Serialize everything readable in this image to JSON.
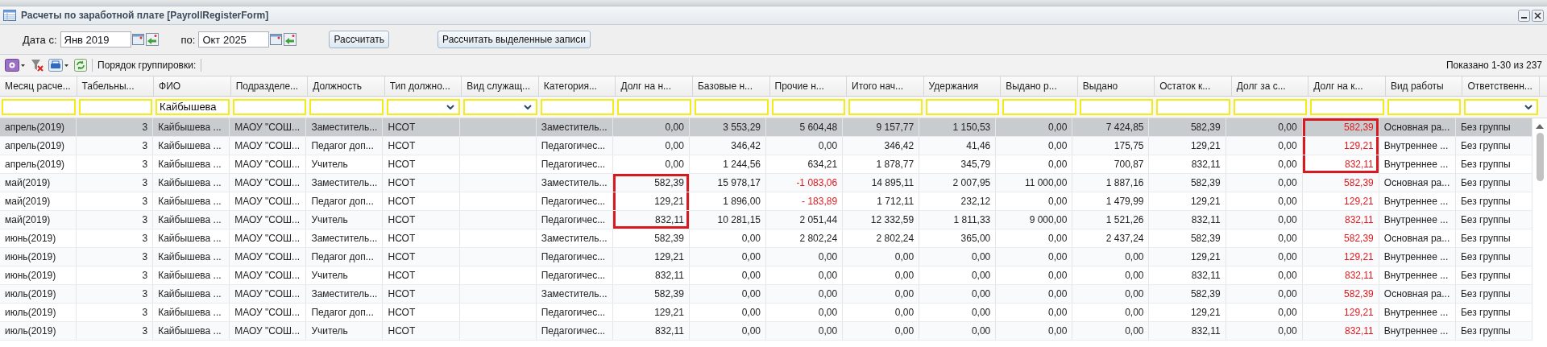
{
  "window": {
    "title": "Расчеты по заработной плате [PayrollRegisterForm]"
  },
  "period": {
    "from_label": "Дата с:",
    "from_value": "Янв 2019",
    "to_label": "по:",
    "to_value": "Окт 2025"
  },
  "buttons": [
    "Рассчитать",
    "Рассчитать выделенные записи"
  ],
  "toolbar": {
    "grouping_label": "Порядок группировки:",
    "paging": "Показано 1-30 из 237"
  },
  "columns": [
    {
      "label": "Месяц расче...",
      "kind": "text"
    },
    {
      "label": "Табельны...",
      "kind": "number"
    },
    {
      "label": "ФИО",
      "kind": "text",
      "filter_value": "Кайбышева"
    },
    {
      "label": "Подразделе...",
      "kind": "text"
    },
    {
      "label": "Должность",
      "kind": "text"
    },
    {
      "label": "Тип должно...",
      "kind": "choice"
    },
    {
      "label": "Вид служащ...",
      "kind": "choice"
    },
    {
      "label": "Категория...",
      "kind": "text"
    },
    {
      "label": "Долг на н...",
      "kind": "number"
    },
    {
      "label": "Базовые н...",
      "kind": "number"
    },
    {
      "label": "Прочие н...",
      "kind": "number"
    },
    {
      "label": "Итого нач...",
      "kind": "number"
    },
    {
      "label": "Удержания",
      "kind": "number"
    },
    {
      "label": "Выдано р...",
      "kind": "number"
    },
    {
      "label": "Выдано",
      "kind": "number"
    },
    {
      "label": "Остаток к...",
      "kind": "number"
    },
    {
      "label": "Долг за с...",
      "kind": "number"
    },
    {
      "label": "Долг на к...",
      "kind": "number"
    },
    {
      "label": "Вид работы",
      "kind": "text"
    },
    {
      "label": "Ответственн...",
      "kind": "choice"
    }
  ],
  "rows": [
    {
      "selected": true,
      "cells": [
        "апрель(2019)",
        "3",
        "Кайбышева ...",
        "МАОУ \"СОШ...",
        "Заместитель...",
        "НСОТ",
        "",
        "Заместитель...",
        "0,00",
        "3 553,29",
        "5 604,48",
        "9 157,77",
        "1 150,53",
        "0,00",
        "7 424,85",
        "582,39",
        "0,00",
        {
          "text": "582,39",
          "red": true,
          "framed": true
        },
        "Основная ра...",
        "Без группы"
      ]
    },
    {
      "selected": false,
      "cells": [
        "апрель(2019)",
        "3",
        "Кайбышева ...",
        "МАОУ \"СОШ...",
        "Педагог доп...",
        "НСОТ",
        "",
        "Педагогичес...",
        "0,00",
        "346,42",
        "0,00",
        "346,42",
        "41,46",
        "0,00",
        "175,75",
        "129,21",
        "0,00",
        {
          "text": "129,21",
          "red": true,
          "framed": true
        },
        "Внутреннее ...",
        "Без группы"
      ]
    },
    {
      "selected": false,
      "cells": [
        "апрель(2019)",
        "3",
        "Кайбышева ...",
        "МАОУ \"СОШ...",
        "Учитель",
        "НСОТ",
        "",
        "Педагогичес...",
        "0,00",
        "1 244,56",
        "634,21",
        "1 878,77",
        "345,79",
        "0,00",
        "700,87",
        "832,11",
        "0,00",
        {
          "text": "832,11",
          "red": true,
          "framed": true
        },
        "Внутреннее ...",
        "Без группы"
      ]
    },
    {
      "selected": false,
      "cells": [
        "май(2019)",
        "3",
        "Кайбышева ...",
        "МАОУ \"СОШ...",
        "Заместитель...",
        "НСОТ",
        "",
        "Заместитель...",
        {
          "text": "582,39",
          "red": false,
          "framed": true
        },
        "15 978,17",
        {
          "text": "-1 083,06",
          "red": true,
          "framed": false
        },
        "14 895,11",
        "2 007,95",
        "11 000,00",
        "1 887,16",
        "582,39",
        "0,00",
        {
          "text": "582,39",
          "red": true,
          "framed": false
        },
        "Основная ра...",
        "Без группы"
      ]
    },
    {
      "selected": false,
      "cells": [
        "май(2019)",
        "3",
        "Кайбышева ...",
        "МАОУ \"СОШ...",
        "Педагог доп...",
        "НСОТ",
        "",
        "Педагогичес...",
        {
          "text": "129,21",
          "red": false,
          "framed": true
        },
        "1 896,00",
        {
          "text": "- 183,89",
          "red": true,
          "framed": false
        },
        "1 712,11",
        "232,12",
        "0,00",
        "1 479,99",
        "129,21",
        "0,00",
        {
          "text": "129,21",
          "red": true,
          "framed": false
        },
        "Внутреннее ...",
        "Без группы"
      ]
    },
    {
      "selected": false,
      "cells": [
        "май(2019)",
        "3",
        "Кайбышева ...",
        "МАОУ \"СОШ...",
        "Учитель",
        "НСОТ",
        "",
        "Педагогичес...",
        {
          "text": "832,11",
          "red": false,
          "framed": true
        },
        "10 281,15",
        "2 051,44",
        "12 332,59",
        "1 811,33",
        "9 000,00",
        "1 521,26",
        "832,11",
        "0,00",
        {
          "text": "832,11",
          "red": true,
          "framed": false
        },
        "Внутреннее ...",
        "Без группы"
      ]
    },
    {
      "selected": false,
      "cells": [
        "июнь(2019)",
        "3",
        "Кайбышева ...",
        "МАОУ \"СОШ...",
        "Заместитель...",
        "НСОТ",
        "",
        "Заместитель...",
        "582,39",
        "0,00",
        "2 802,24",
        "2 802,24",
        "365,00",
        "0,00",
        "2 437,24",
        "582,39",
        "0,00",
        {
          "text": "582,39",
          "red": true,
          "framed": false
        },
        "Основная ра...",
        "Без группы"
      ]
    },
    {
      "selected": false,
      "cells": [
        "июнь(2019)",
        "3",
        "Кайбышева ...",
        "МАОУ \"СОШ...",
        "Педагог доп...",
        "НСОТ",
        "",
        "Педагогичес...",
        "129,21",
        "0,00",
        "0,00",
        "0,00",
        "0,00",
        "0,00",
        "0,00",
        "129,21",
        "0,00",
        {
          "text": "129,21",
          "red": true,
          "framed": false
        },
        "Внутреннее ...",
        "Без группы"
      ]
    },
    {
      "selected": false,
      "cells": [
        "июнь(2019)",
        "3",
        "Кайбышева ...",
        "МАОУ \"СОШ...",
        "Учитель",
        "НСОТ",
        "",
        "Педагогичес...",
        "832,11",
        "0,00",
        "0,00",
        "0,00",
        "0,00",
        "0,00",
        "0,00",
        "832,11",
        "0,00",
        {
          "text": "832,11",
          "red": true,
          "framed": false
        },
        "Внутреннее ...",
        "Без группы"
      ]
    },
    {
      "selected": false,
      "cells": [
        "июль(2019)",
        "3",
        "Кайбышева ...",
        "МАОУ \"СОШ...",
        "Заместитель...",
        "НСОТ",
        "",
        "Заместитель...",
        "582,39",
        "0,00",
        "0,00",
        "0,00",
        "0,00",
        "0,00",
        "0,00",
        "582,39",
        "0,00",
        {
          "text": "582,39",
          "red": true,
          "framed": false
        },
        "Основная ра...",
        "Без группы"
      ]
    },
    {
      "selected": false,
      "cells": [
        "июль(2019)",
        "3",
        "Кайбышева ...",
        "МАОУ \"СОШ...",
        "Педагог доп...",
        "НСОТ",
        "",
        "Педагогичес...",
        "129,21",
        "0,00",
        "0,00",
        "0,00",
        "0,00",
        "0,00",
        "0,00",
        "129,21",
        "0,00",
        {
          "text": "129,21",
          "red": true,
          "framed": false
        },
        "Внутреннее ...",
        "Без группы"
      ]
    },
    {
      "selected": false,
      "cells": [
        "июль(2019)",
        "3",
        "Кайбышева ...",
        "МАОУ \"СОШ...",
        "Учитель",
        "НСОТ",
        "",
        "Педагогичес...",
        "832,11",
        "0,00",
        "0,00",
        "0,00",
        "0,00",
        "0,00",
        "0,00",
        "832,11",
        "0,00",
        {
          "text": "832,11",
          "red": true,
          "framed": false
        },
        "Внутреннее ...",
        "Без группы"
      ]
    }
  ]
}
